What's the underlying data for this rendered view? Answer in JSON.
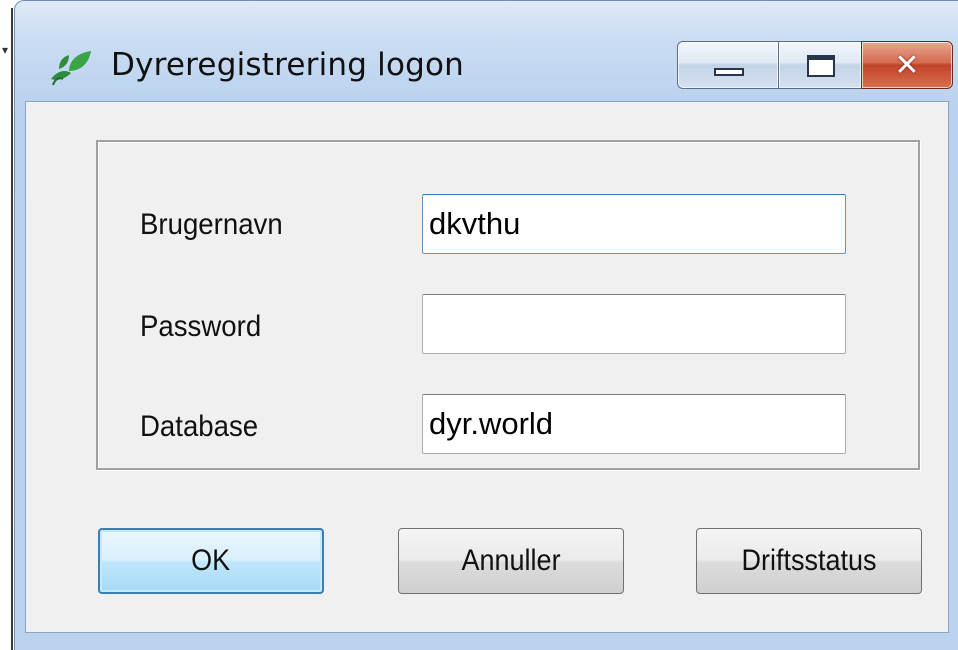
{
  "window": {
    "title": "Dyreregistrering logon",
    "controls": {
      "minimize": "minimize",
      "maximize": "maximize",
      "close": "close"
    }
  },
  "form": {
    "username": {
      "label": "Brugernavn",
      "value": "dkvthu"
    },
    "password": {
      "label": "Password",
      "value": ""
    },
    "database": {
      "label": "Database",
      "value": "dyr.world"
    }
  },
  "buttons": {
    "ok": "OK",
    "cancel": "Annuller",
    "status": "Driftsstatus"
  },
  "colors": {
    "titlebar": "#c9dcf2",
    "client": "#f0f0f0",
    "close_button": "#c1442a",
    "default_button_border": "#3c7fb1",
    "icon_green": "#2e8b3a"
  },
  "icons": {
    "app": "leaf-icon",
    "minimize": "minimize-icon",
    "maximize": "maximize-icon",
    "close": "close-icon"
  }
}
